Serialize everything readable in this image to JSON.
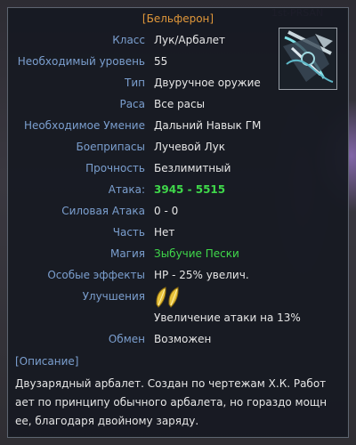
{
  "item": {
    "title": "[Бельферон]",
    "icon": "crossbow-icon",
    "rows": [
      {
        "label": "Класс",
        "value": "Лук/Арбалет"
      },
      {
        "label": "Необходимый уровень",
        "value": "55"
      },
      {
        "label": "Тип",
        "value": "Двуручное оружие"
      },
      {
        "label": "Раса",
        "value": "Все расы"
      },
      {
        "label": "Необходимое Умение",
        "value": "Дальний Навык ГМ"
      },
      {
        "label": "Боеприпасы",
        "value": "Лучевой Лук"
      },
      {
        "label": "Прочность",
        "value": "Безлимитный"
      },
      {
        "label": "Атака:",
        "value": "3945 - 5515"
      },
      {
        "label": "Силовая Атака",
        "value": "0 - 0"
      },
      {
        "label": "Часть",
        "value": "Нет"
      },
      {
        "label": "Магия",
        "value": "Зыбучие Пески"
      },
      {
        "label": "Особые эффекты",
        "value": "HP - 25% увелич."
      },
      {
        "label": "Улучшения",
        "value": ""
      },
      {
        "label": "",
        "value": "Увеличение атаки на 13%"
      },
      {
        "label": "Обмен",
        "value": "Возможен"
      }
    ],
    "enhancements": {
      "count": 2,
      "icon": "feather-icon",
      "color": "#e8c23a"
    },
    "description_title": "[Описание]",
    "description": "Двузарядный арбалет. Создан по чертежам Х.К. Работ ает по принципу обычного арбалета, но гораздо мощн ее, благодаря двойному заряду."
  },
  "colors": {
    "title": "#e0973a",
    "label": "#7b9fcf",
    "value": "#e6e6e6",
    "highlight": "#3fd84a"
  }
}
